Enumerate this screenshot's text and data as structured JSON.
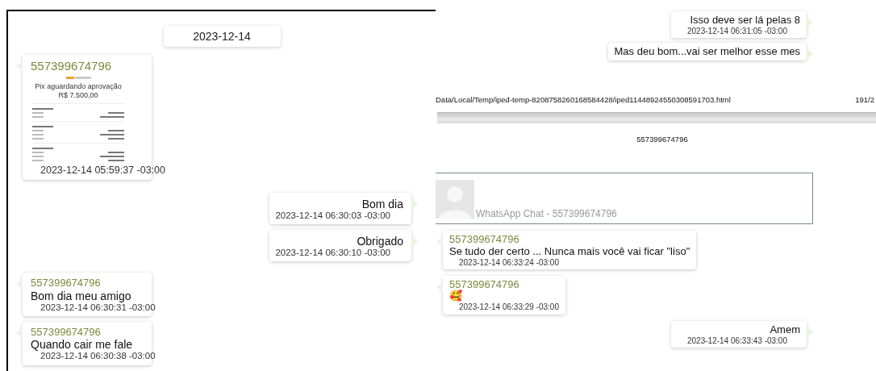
{
  "left_pane": {
    "date_divider": "2023-12-14",
    "messages": [
      {
        "outgoing": false,
        "sender": "557399674796",
        "kind": "image",
        "receipt": {
          "title": "Pix aguardando aprovação",
          "amount": "R$ 7.500,00"
        },
        "time": "2023-12-14 05:59:37 -03:00"
      },
      {
        "outgoing": true,
        "kind": "text",
        "text": "Bom dia",
        "time": "2023-12-14 06:30:03 -03:00"
      },
      {
        "outgoing": true,
        "kind": "text",
        "text": "Obrigado",
        "time": "2023-12-14 06:30:10 -03:00"
      },
      {
        "outgoing": false,
        "sender": "557399674796",
        "kind": "text",
        "text": "Bom dia meu amigo",
        "time": "2023-12-14 06:30:31 -03:00"
      },
      {
        "outgoing": false,
        "sender": "557399674796",
        "kind": "text",
        "text": "Quando cair me fale",
        "time": "2023-12-14 06:30:38 -03:00"
      }
    ]
  },
  "right_pane": {
    "top_messages": [
      {
        "outgoing": true,
        "kind": "text",
        "text": "Isso deve ser lá pelas 8",
        "time": "2023-12-14 06:31:05 -03:00"
      },
      {
        "outgoing": true,
        "kind": "text",
        "text": "Mas deu bom...vai ser melhor esse mes"
      }
    ],
    "file_path": "Data/Local/Temp/iped-temp-8208758260168584428/iped11448924550308591703.html",
    "page_count": "191/2",
    "chat_title": "557399674796",
    "chat_header": {
      "title": "WhatsApp Chat - 557399674796"
    },
    "messages": [
      {
        "outgoing": false,
        "sender": "557399674796",
        "kind": "text",
        "text": "Se tudo der certo ... Nunca mais você vai ficar \"liso\"",
        "time": "2023-12-14 06:33:24 -03:00"
      },
      {
        "outgoing": false,
        "sender": "557399674796",
        "kind": "text",
        "text": "🥰",
        "time": "2023-12-14 06:33:29 -03:00"
      },
      {
        "outgoing": true,
        "kind": "text",
        "text": "Amem",
        "time": "2023-12-14 06:33:43 -03:00"
      }
    ]
  }
}
